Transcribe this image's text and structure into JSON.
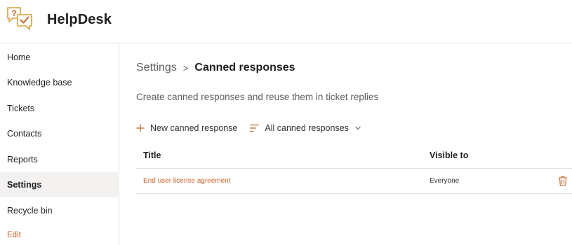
{
  "app": {
    "title": "HelpDesk",
    "logo_icon": "helpdesk-chat-check-icon"
  },
  "sidebar": {
    "items": [
      {
        "label": "Home"
      },
      {
        "label": "Knowledge base"
      },
      {
        "label": "Tickets"
      },
      {
        "label": "Contacts"
      },
      {
        "label": "Reports"
      },
      {
        "label": "Settings",
        "selected": true
      },
      {
        "label": "Recycle bin"
      }
    ],
    "edit_label": "Edit"
  },
  "breadcrumb": {
    "root": "Settings",
    "separator": ">",
    "current": "Canned responses"
  },
  "description": "Create canned responses and reuse them in ticket replies",
  "toolbar": {
    "new_label": "New canned response",
    "new_icon": "plus-icon",
    "view_label": "All canned responses",
    "view_icon": "filter-lines-icon",
    "view_chevron_icon": "chevron-down-icon"
  },
  "table": {
    "columns": {
      "title": "Title",
      "visible_to": "Visible to"
    },
    "rows": [
      {
        "title": "End user license agreement",
        "visible_to": "Everyone",
        "action_icon": "trash-icon"
      }
    ]
  },
  "colors": {
    "accent": "#c9632b",
    "selected_bg": "#f3f2f1",
    "border": "#e1dfdd"
  }
}
